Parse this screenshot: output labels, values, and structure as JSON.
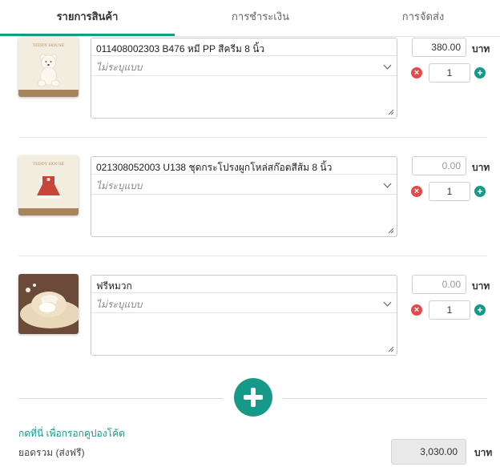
{
  "tabs": [
    {
      "label": "รายการสินค้า",
      "active": true
    },
    {
      "label": "การชำระเงิน",
      "active": false
    },
    {
      "label": "การจัดส่ง",
      "active": false
    }
  ],
  "accent_color": "#17998a",
  "remove_color": "#e24b4b",
  "items": [
    {
      "name": "011408002303 B476 หมี PP สีครีม 8 นิ้ว",
      "variant_placeholder": "ไม่ระบุแบบ",
      "price": "380.00",
      "currency": "บาท",
      "quantity": "1",
      "image_brand": "TEDDY HOUSE"
    },
    {
      "name": "021308052003 U138 ชุดกระโปรงผูกโหล่สก๊อตสีส้ม 8 นิ้ว",
      "variant_placeholder": "ไม่ระบุแบบ",
      "price": "0.00",
      "currency": "บาท",
      "quantity": "1",
      "image_brand": "TEDDY HOUSE"
    },
    {
      "name": "ฟรีหมวก",
      "variant_placeholder": "ไม่ระบุแบบ",
      "price": "0.00",
      "currency": "บาท",
      "quantity": "1"
    }
  ],
  "coupon_link": "กดที่นี่ เพื่อกรอกคูปองโค้ด",
  "total": {
    "label": "ยอดรวม (ส่งฟรี)",
    "value": "3,030.00",
    "currency": "บาท"
  },
  "icons": {
    "remove": "remove-circle-icon",
    "add": "add-circle-icon",
    "add_item": "add-item-plus-icon",
    "dropdown": "chevron-down-icon",
    "resize": "resize-grip-icon"
  }
}
